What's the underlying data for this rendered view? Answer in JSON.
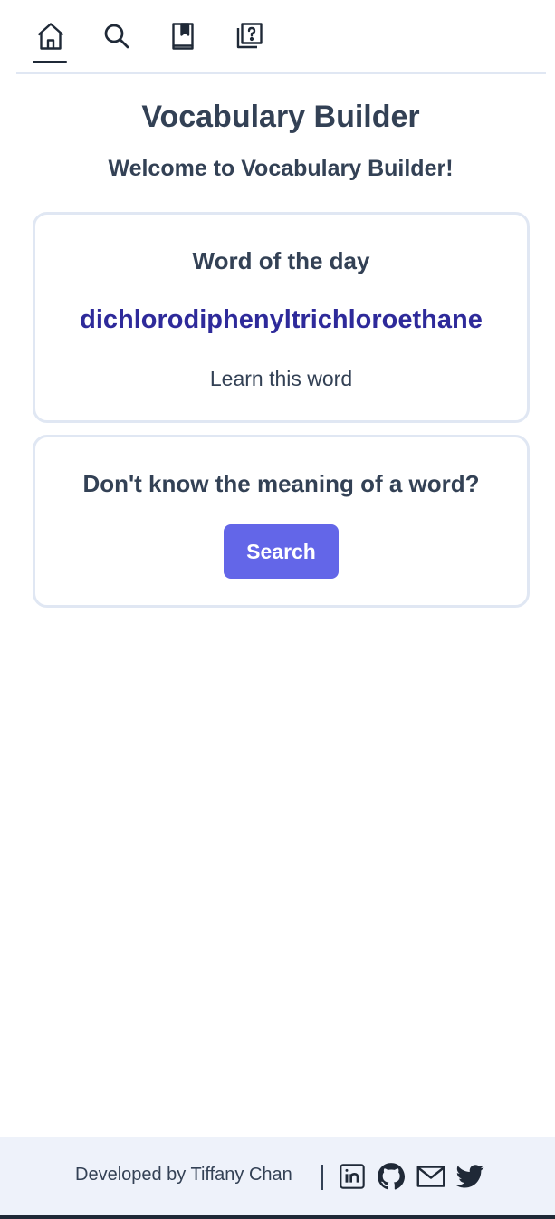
{
  "nav": {
    "items": [
      {
        "icon": "home-icon",
        "active": true
      },
      {
        "icon": "search-icon",
        "active": false
      },
      {
        "icon": "bookmark-book-icon",
        "active": false
      },
      {
        "icon": "quiz-icon",
        "active": false
      }
    ]
  },
  "header": {
    "title": "Vocabulary Builder",
    "welcome": "Welcome to Vocabulary Builder!"
  },
  "word_card": {
    "heading": "Word of the day",
    "word": "dichlorodiphenyltrichloroethane",
    "learn_label": "Learn this word"
  },
  "search_card": {
    "heading": "Don't know the meaning of a word?",
    "button_label": "Search"
  },
  "footer": {
    "credit": "Developed by Tiffany Chan",
    "divider": "|",
    "social": [
      "linkedin-icon",
      "github-icon",
      "mail-icon",
      "twitter-icon"
    ]
  },
  "colors": {
    "text": "#334155",
    "accent": "#6366e8",
    "word": "#2e2a9a",
    "border": "#e0e7f3",
    "footer_bg": "#eef2fa"
  }
}
